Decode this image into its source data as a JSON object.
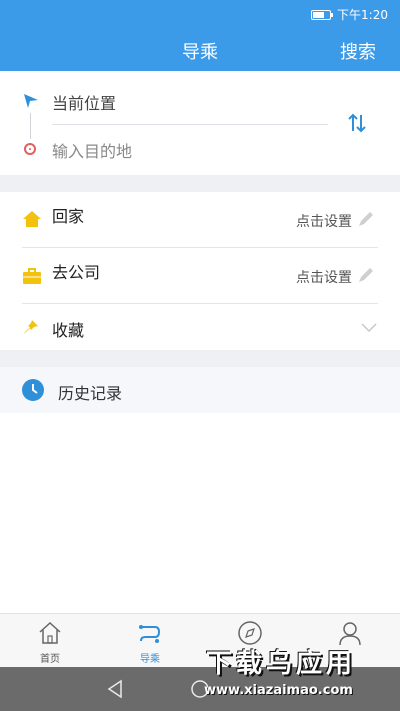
{
  "status": {
    "time": "下午1:20"
  },
  "header": {
    "title": "导乘",
    "search_label": "搜索"
  },
  "route": {
    "origin": "当前位置",
    "destination_placeholder": "输入目的地"
  },
  "shortcuts": [
    {
      "label": "回家",
      "hint": "点击设置",
      "icon": "home-icon"
    },
    {
      "label": "去公司",
      "hint": "点击设置",
      "icon": "briefcase-icon"
    },
    {
      "label": "收藏",
      "icon": "pin-icon"
    }
  ],
  "history": {
    "label": "历史记录",
    "icon": "clock-icon"
  },
  "tabs": [
    {
      "label": "首页",
      "icon": "home-outline-icon"
    },
    {
      "label": "导乘",
      "icon": "route-icon",
      "active": true
    },
    {
      "label": "",
      "icon": "compass-icon"
    },
    {
      "label": "",
      "icon": "user-icon"
    }
  ],
  "watermark": {
    "title": "下载乌应用",
    "url": "www.xiazaimao.com"
  },
  "colors": {
    "accent": "#3c9be8",
    "band": "#eef0f4",
    "icon_yellow": "#f2c20f"
  }
}
